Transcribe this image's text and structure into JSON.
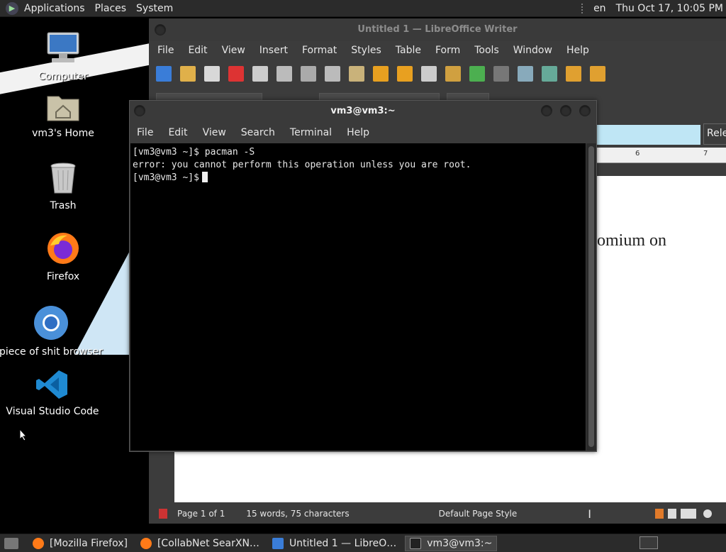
{
  "top_panel": {
    "menus": [
      "Applications",
      "Places",
      "System"
    ],
    "language": "en",
    "clock": "Thu Oct 17, 10:05 PM"
  },
  "desktop": {
    "icons": [
      {
        "label": "Computer",
        "icon": "computer-icon"
      },
      {
        "label": "vm3's Home",
        "icon": "home-folder-icon"
      },
      {
        "label": "Trash",
        "icon": "trash-icon"
      },
      {
        "label": "Firefox",
        "icon": "firefox-icon"
      },
      {
        "label": "piece of shit browser",
        "icon": "chromium-icon"
      },
      {
        "label": "Visual Studio Code",
        "icon": "vscode-icon"
      }
    ]
  },
  "writer": {
    "title": "Untitled 1 — LibreOffice Writer",
    "menu": [
      "File",
      "Edit",
      "View",
      "Insert",
      "Format",
      "Styles",
      "Table",
      "Form",
      "Tools",
      "Window",
      "Help"
    ],
    "search_button": "Rele",
    "doc_text": "romium on",
    "ruler_marks": [
      "6",
      "7"
    ],
    "status": {
      "page": "Page 1 of 1",
      "words": "15 words, 75 characters",
      "page_style": "Default Page Style"
    }
  },
  "terminal": {
    "title": "vm3@vm3:~",
    "menu": [
      "File",
      "Edit",
      "View",
      "Search",
      "Terminal",
      "Help"
    ],
    "lines": [
      "[vm3@vm3 ~]$ pacman -S",
      "error: you cannot perform this operation unless you are root.",
      "[vm3@vm3 ~]$"
    ]
  },
  "taskbar": {
    "items": [
      {
        "label": "[Mozilla Firefox]",
        "icon": "firefox-icon"
      },
      {
        "label": "[CollabNet SearXN…",
        "icon": "firefox-icon"
      },
      {
        "label": "Untitled 1 — LibreO…",
        "icon": "writer-icon"
      },
      {
        "label": "vm3@vm3:~",
        "icon": "terminal-icon"
      }
    ]
  },
  "colors": {
    "panel": "#2b2b2b",
    "window": "#3a3a3a",
    "terminal_bg": "#000000",
    "highlight": "#bfe6f5"
  }
}
